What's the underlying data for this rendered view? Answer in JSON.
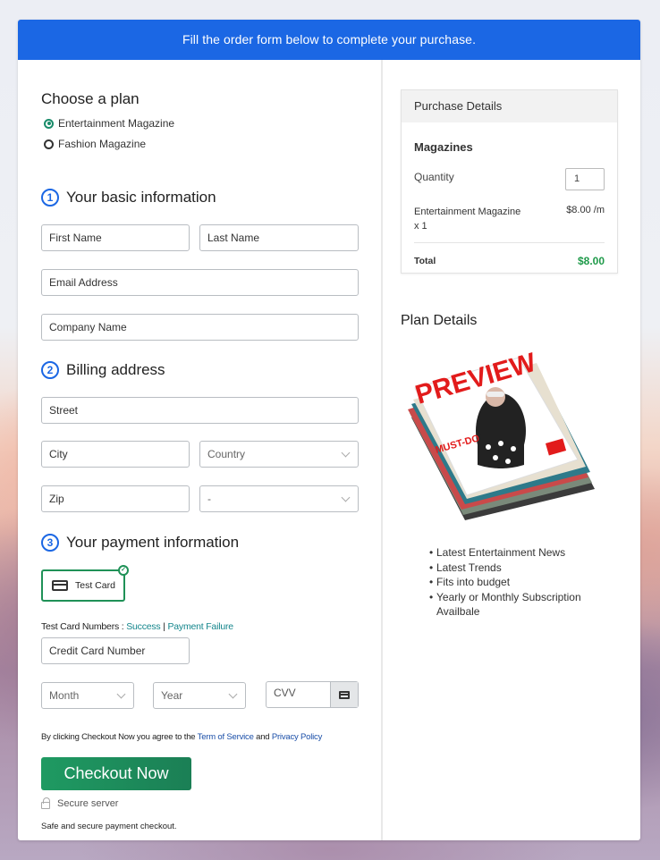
{
  "banner": {
    "text": "Fill the order form below to complete your purchase."
  },
  "plan": {
    "heading": "Choose a plan",
    "options": [
      {
        "label": "Entertainment Magazine",
        "selected": true
      },
      {
        "label": "Fashion Magazine",
        "selected": false
      }
    ]
  },
  "basic": {
    "number": "1",
    "heading": "Your basic information",
    "first_name": "First Name",
    "last_name": "Last Name",
    "email": "Email Address",
    "company": "Company Name"
  },
  "billing": {
    "number": "2",
    "heading": "Billing address",
    "street": "Street",
    "city": "City",
    "country": "Country",
    "zip": "Zip",
    "state": "-"
  },
  "payment": {
    "number": "3",
    "heading": "Your payment information",
    "method_label": "Test Card",
    "test_numbers_prefix": "Test Card Numbers : ",
    "success_link": "Success",
    "separator": " | ",
    "failure_link": "Payment Failure",
    "card_number": "Credit Card Number",
    "month": "Month",
    "year": "Year",
    "cvv": "CVV"
  },
  "agreement": {
    "prefix": "By clicking Checkout Now you agree to the ",
    "tos": "Term of Service",
    "and": " and ",
    "privacy": "Privacy Policy"
  },
  "checkout": {
    "button": "Checkout Now",
    "secure": "Secure server",
    "safe": "Safe and secure payment checkout."
  },
  "purchase": {
    "heading": "Purchase Details",
    "category": "Magazines",
    "quantity_label": "Quantity",
    "quantity": "1",
    "item_name": "Entertainment Magazine",
    "item_qty": "x 1",
    "item_price": "$8.00 /m",
    "total_label": "Total",
    "total": "$8.00",
    "total_color": "#1f9a4a"
  },
  "plan_details": {
    "heading": "Plan Details",
    "image_alt": "PREVIEW magazine stack",
    "magazine_title": "PREVIEW",
    "features": [
      "Latest Entertainment News",
      "Latest Trends",
      "Fits into budget",
      "Yearly or Monthly Subscription Availbale"
    ]
  },
  "colors": {
    "banner": "#1b67e4",
    "checkout": "#1e8a5c",
    "accent_teal": "#14868c"
  }
}
